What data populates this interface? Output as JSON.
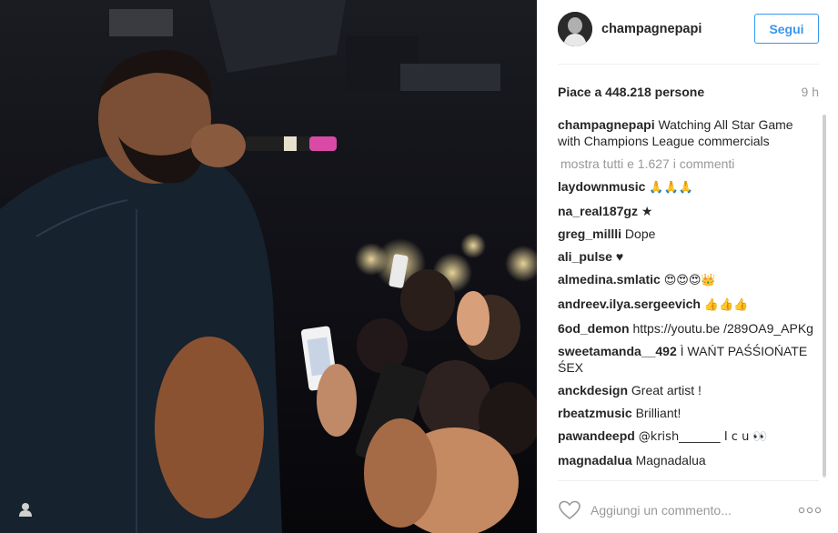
{
  "post": {
    "username": "champagnepapi",
    "follow_label": "Segui",
    "likes_text": "Piace a 448.218 persone",
    "time_ago": "9 h"
  },
  "comments": {
    "caption": {
      "user": "champagnepapi",
      "text": "Watching All Star Game with Champions League commercials"
    },
    "show_all_label": "mostra tutti e 1.627 i commenti",
    "items": [
      {
        "user": "laydownmusic",
        "text": "🙏🙏🙏"
      },
      {
        "user": "na_real187gz",
        "text": "★"
      },
      {
        "user": "greg_millli",
        "text": "Dope"
      },
      {
        "user": "ali_pulse",
        "text": "♥"
      },
      {
        "user": "almedina.smlatic",
        "text": "😍😍😍👑"
      },
      {
        "user": "andreev.ilya.sergeevich",
        "text": "👍👍👍"
      },
      {
        "user": "6od_demon",
        "text": "https://youtu.be /289OA9_APKg"
      },
      {
        "user": "sweetamanda__492",
        "text": "Ì WAŃT PAŚŚIOŃATE ŚEX"
      },
      {
        "user": "anckdesign",
        "text": "Great artist !"
      },
      {
        "user": "rbeatzmusic",
        "text": "Brilliant!"
      },
      {
        "user": "pawandeepd",
        "text": "@krish_______ I c u 👀"
      },
      {
        "user": "magnadalua",
        "text": "Magnadalua"
      }
    ]
  },
  "footer": {
    "comment_placeholder": "Aggiungi un commento..."
  },
  "icons": {
    "like": "heart-outline-icon",
    "options": "ellipsis-icon",
    "tagged_users": "person-icon"
  },
  "colors": {
    "accent": "#3897f0",
    "text": "#262626",
    "muted": "#999999"
  }
}
